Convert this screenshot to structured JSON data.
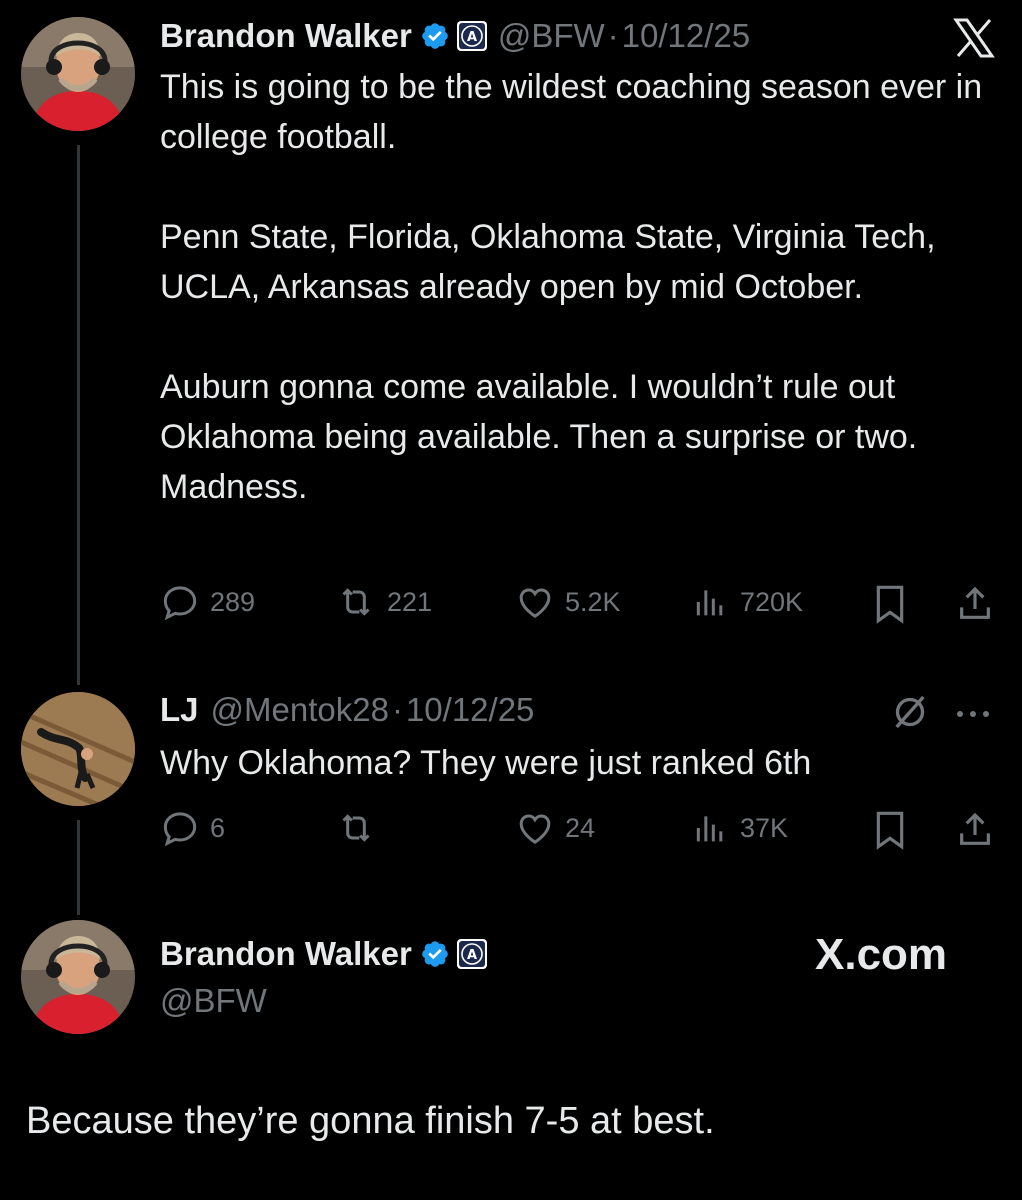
{
  "tweet1": {
    "name": "Brandon Walker",
    "handle": "@BFW",
    "date": "10/12/25",
    "paragraphs": [
      "This is going to be the wildest coaching season ever in college football.",
      "Penn State, Florida, Oklahoma State, Virginia Tech, UCLA, Arkansas already open by mid October.",
      "Auburn gonna come available. I wouldn’t rule out Oklahoma being available. Then a surprise or two. Madness."
    ],
    "stats": {
      "replies": "289",
      "reposts": "221",
      "likes": "5.2K",
      "views": "720K"
    }
  },
  "tweet2": {
    "name": "LJ",
    "handle": "@Mentok28",
    "date": "10/12/25",
    "text": "Why Oklahoma? They were just ranked 6th",
    "stats": {
      "replies": "6",
      "reposts": "",
      "likes": "24",
      "views": "37K"
    }
  },
  "tweet3": {
    "name": "Brandon Walker",
    "handle": "@BFW",
    "site": "X.com",
    "text": "Because they’re gonna finish 7-5 at best."
  },
  "colors": {
    "background": "#000000",
    "text": "#e7e9ea",
    "muted": "#71767b",
    "verified": "#1d9bf0"
  },
  "icons": [
    "reply-icon",
    "repost-icon",
    "like-icon",
    "views-icon",
    "bookmark-icon",
    "share-icon",
    "verified-badge-icon",
    "barstool-affiliate-icon",
    "x-logo-icon",
    "grok-icon",
    "more-icon"
  ]
}
